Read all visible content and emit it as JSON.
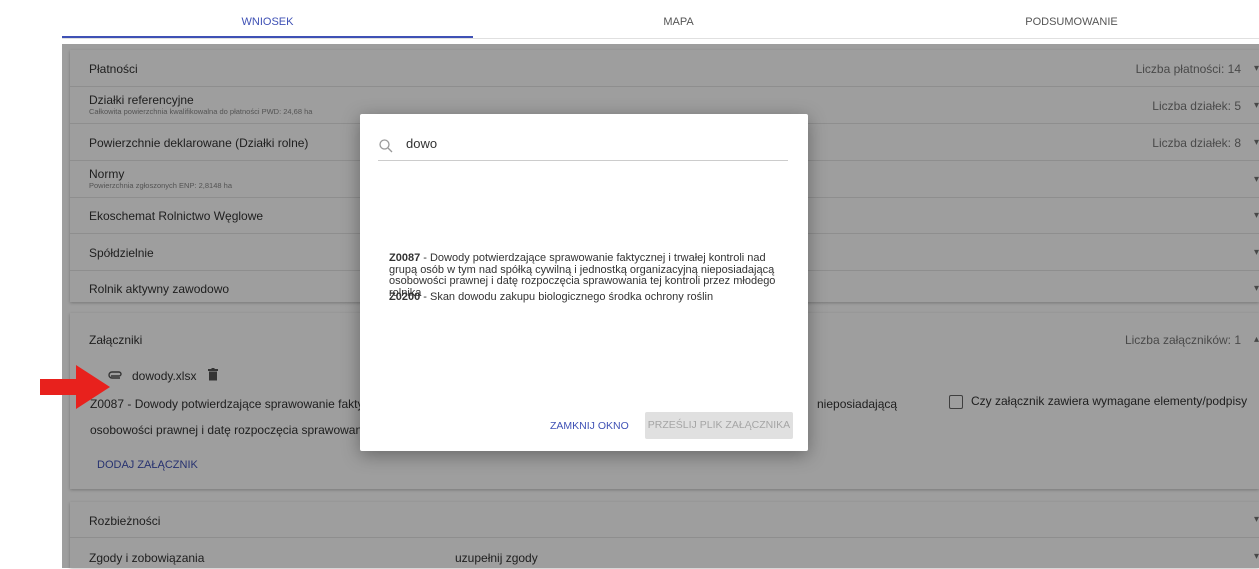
{
  "tabs": [
    "WNIOSEK",
    "MAPA",
    "PODSUMOWANIE"
  ],
  "sections": {
    "platnosci": {
      "label": "Płatności",
      "right": "Liczba płatności: 14"
    },
    "dzialki": {
      "label": "Działki referencyjne",
      "sub": "Całkowita powierzchnia kwalifikowalna do płatności PWD: 24,68 ha",
      "right": "Liczba działek: 5"
    },
    "powierzchnie": {
      "label": "Powierzchnie deklarowane (Działki rolne)",
      "right": "Liczba działek: 8"
    },
    "normy": {
      "label": "Normy",
      "sub": "Powierzchnia zgłoszonych ENP: 2,8148 ha"
    },
    "ekoschemat": {
      "label": "Ekoschemat Rolnictwo Węglowe"
    },
    "spoldzielnie": {
      "label": "Spółdzielnie"
    },
    "rolnik": {
      "label": "Rolnik aktywny zawodowo"
    },
    "zalaczniki": {
      "label": "Załączniki",
      "right": "Liczba załączników: 1"
    },
    "rozbieznosci": {
      "label": "Rozbieżności"
    },
    "zgody": {
      "label": "Zgody i zobowiązania",
      "warning": "uzupełnij zgody"
    }
  },
  "attachment": {
    "filename": "dowody.xlsx",
    "desc_line1_start": "Z0087 - Dowody potwierdzające sprawowanie fakty",
    "desc_line1_end": "nieposiadającą",
    "desc_line2": "osobowości prawnej i datę rozpoczęcia sprawowan",
    "checkbox_label": "Czy załącznik zawiera wymagane elementy/podpisy",
    "add_label": "DODAJ ZAŁĄCZNIK"
  },
  "modal": {
    "search_value": "dowo",
    "options": [
      {
        "code": "Z0087",
        "text": " - Dowody potwierdzające sprawowanie faktycznej i trwałej kontroli nad grupą osób w tym nad spółką cywilną i jednostką organizacyjną nieposiadającą osobowości prawnej i datę rozpoczęcia sprawowania tej kontroli przez młodego rolnika"
      },
      {
        "code": "Z0200",
        "text": " - Skan dowodu zakupu biologicznego środka ochrony roślin"
      }
    ],
    "close_label": "ZAMKNIJ OKNO",
    "upload_label": "PRZEŚLIJ PLIK ZAŁĄCZNIKA"
  },
  "colors": {
    "accent": "#3f51b5",
    "arrow": "#e8211d",
    "warning": "#d32f2f"
  }
}
